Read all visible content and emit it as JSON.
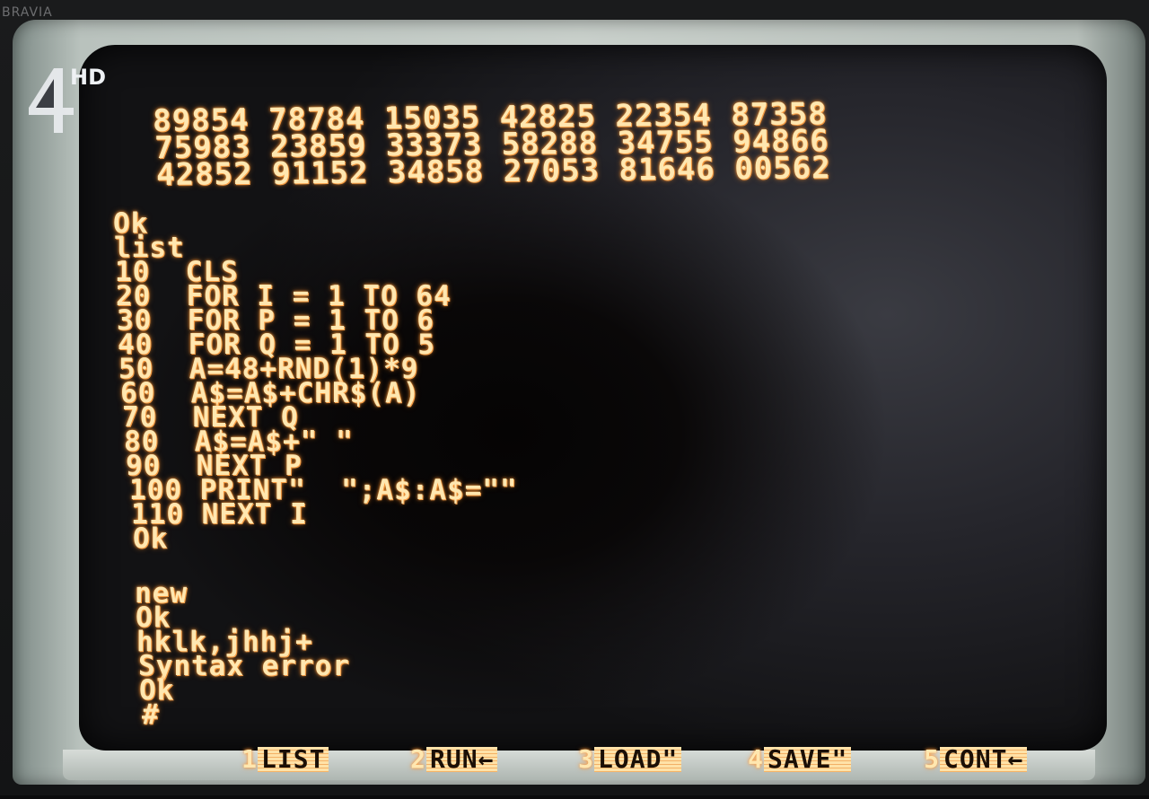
{
  "tv": {
    "brand": "BRAVIA"
  },
  "channel": {
    "logo_text": "4",
    "hd_label": "HD"
  },
  "terminal": {
    "number_rows": [
      "89854 78784 15035 42825 22354 87358",
      "75983 23859 33373 58288 34755 94866",
      "42852 91152 34858 27053 81646 00562"
    ],
    "lines": [
      "Ok",
      "list",
      "10  CLS",
      "20  FOR I = 1 TO 64",
      "30  FOR P = 1 TO 6",
      "40  FOR Q = 1 TO 5",
      "50  A=48+RND(1)*9",
      "60  A$=A$+CHR$(A)",
      "70  NEXT Q",
      "80  A$=A$+\" \"",
      "90  NEXT P",
      "100 PRINT\"  \";A$:A$=\"\"",
      "110 NEXT I",
      "Ok",
      "new",
      "Ok",
      "hklk,jhhj+",
      "Syntax error",
      "Ok",
      "#"
    ]
  },
  "function_keys": [
    {
      "num": "1",
      "label": "LIST"
    },
    {
      "num": "2",
      "label": "RUN←"
    },
    {
      "num": "3",
      "label": "LOAD\""
    },
    {
      "num": "4",
      "label": "SAVE\""
    },
    {
      "num": "5",
      "label": "CONT←"
    }
  ]
}
